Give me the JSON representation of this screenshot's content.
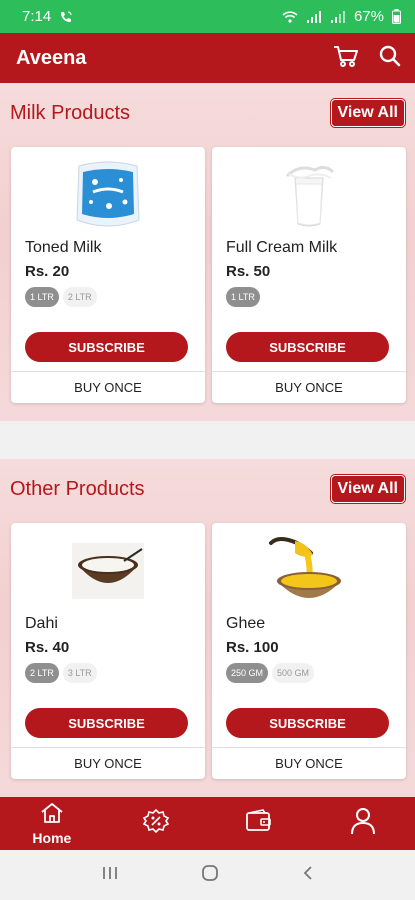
{
  "status_bar": {
    "time": "7:14",
    "battery": "67%"
  },
  "app_bar": {
    "title": "Aveena"
  },
  "sections": [
    {
      "title": "Milk Products",
      "view_all": "View All",
      "products": [
        {
          "name": "Toned Milk",
          "price": "Rs. 20",
          "variants": [
            "1 LTR",
            "2 LTR"
          ],
          "selected_variant": "1 LTR",
          "subscribe": "SUBSCRIBE",
          "buy_once": "BUY ONCE"
        },
        {
          "name": "Full Cream Milk",
          "price": "Rs. 50",
          "variants": [
            "1 LTR"
          ],
          "selected_variant": "1 LTR",
          "subscribe": "SUBSCRIBE",
          "buy_once": "BUY ONCE"
        }
      ]
    },
    {
      "title": "Other Products",
      "view_all": "View All",
      "products": [
        {
          "name": "Dahi",
          "price": "Rs. 40",
          "variants": [
            "2 LTR",
            "3 LTR"
          ],
          "selected_variant": "2 LTR",
          "subscribe": "SUBSCRIBE",
          "buy_once": "BUY ONCE"
        },
        {
          "name": "Ghee",
          "price": "Rs. 100",
          "variants": [
            "250 GM",
            "500 GM"
          ],
          "selected_variant": "250 GM",
          "subscribe": "SUBSCRIBE",
          "buy_once": "BUY ONCE"
        }
      ]
    }
  ],
  "bottom_nav": {
    "home_label": "Home"
  },
  "colors": {
    "primary": "#b4181d",
    "status_bar": "#2ebd5b",
    "section_bg": "#f2cfd0"
  }
}
